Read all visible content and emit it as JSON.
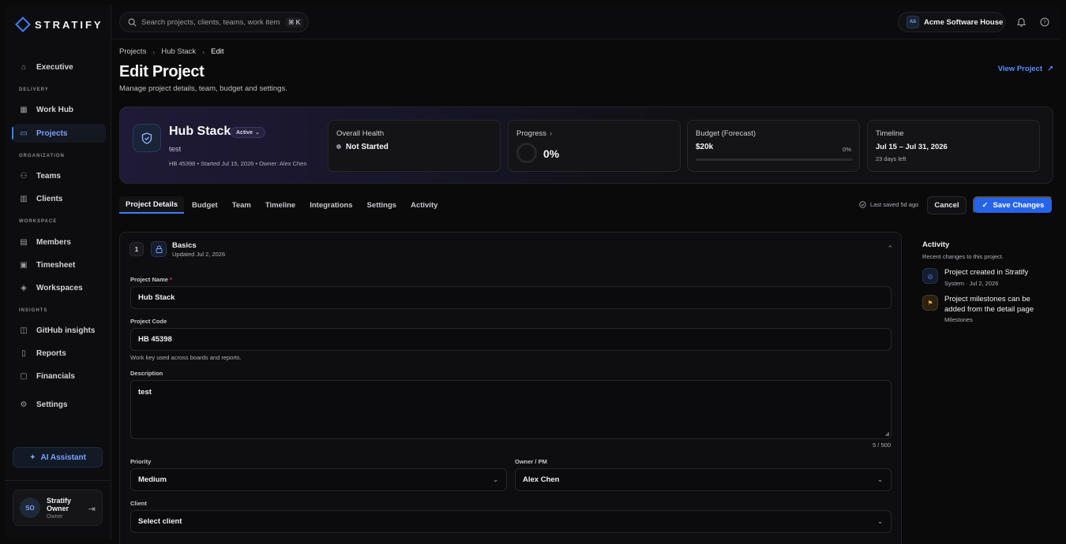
{
  "brand": {
    "name": "STRATIFY"
  },
  "sidebar": {
    "sections": {
      "delivery": "DELIVERY",
      "organization": "ORGANIZATION",
      "workspace": "WORKSPACE",
      "insights": "INSIGHTS"
    },
    "items": {
      "executive": "Executive",
      "work_hub": "Work Hub",
      "projects": "Projects",
      "teams": "Teams",
      "clients": "Clients",
      "members": "Members",
      "timesheet": "Timesheet",
      "workspaces": "Workspaces",
      "github_insights": "GitHub insights",
      "reports": "Reports",
      "financials": "Financials",
      "settings": "Settings"
    },
    "ai_button": "AI Assistant",
    "user": {
      "initials": "SO",
      "name_line1": "Stratify",
      "name_line2": "Owner",
      "role": "Owner"
    }
  },
  "topbar": {
    "search_placeholder": "Search projects, clients, teams, work items…",
    "shortcut": "⌘ K",
    "org": {
      "initials": "AS",
      "name": "Acme Software House"
    }
  },
  "breadcrumb": {
    "projects": "Projects",
    "project": "Hub Stack",
    "current": "Edit"
  },
  "header": {
    "title": "Edit Project",
    "subtitle": "Manage project details, team, budget and settings.",
    "view_link": "View Project"
  },
  "hero": {
    "name": "Hub Stack",
    "status": "Active",
    "description": "test",
    "meta": "HB 45398 • Started Jul 15, 2026 • Owner: Alex Chen",
    "health": {
      "label": "Overall Health",
      "value": "Not Started"
    },
    "progress": {
      "label": "Progress",
      "value": "0%",
      "fraction": 0
    },
    "budget": {
      "label": "Budget (Forecast)",
      "value": "$20k",
      "pct": "0%",
      "fraction": 0
    },
    "timeline": {
      "label": "Timeline",
      "value": "Jul 15 – Jul 31, 2026",
      "sub": "23 days left"
    }
  },
  "tabs": [
    "Project Details",
    "Budget",
    "Team",
    "Timeline",
    "Integrations",
    "Settings",
    "Activity"
  ],
  "actions": {
    "saved": "Last saved 5d ago",
    "cancel": "Cancel",
    "save": "Save Changes"
  },
  "form": {
    "step": "1",
    "section_title": "Basics",
    "section_sub": "Updated Jul 2, 2026",
    "name_label": "Project Name",
    "name_required": "*",
    "name_value": "Hub Stack",
    "code_label": "Project Code",
    "code_value": "HB 45398",
    "code_hint": "Work key used across boards and reports.",
    "desc_label": "Description",
    "desc_value": "test",
    "desc_counter": "5 / 500",
    "priority_label": "Priority",
    "priority_value": "Medium",
    "owner_label": "Owner / PM",
    "owner_value": "Alex Chen",
    "client_label": "Client",
    "client_value": "Select client"
  },
  "activity": {
    "title": "Activity",
    "subtitle": "Recent changes to this project.",
    "items": [
      {
        "text": "Project created in Stratify",
        "meta": "System · Jul 2, 2026",
        "color": "#5b8cff"
      },
      {
        "text": "Project milestones can be added from the detail page",
        "meta": "Milestones",
        "color": "#e0a84a"
      }
    ]
  },
  "colors": {
    "accent": "#3b82f6",
    "link": "#5b8cff",
    "primary_button": "#2563eb"
  }
}
